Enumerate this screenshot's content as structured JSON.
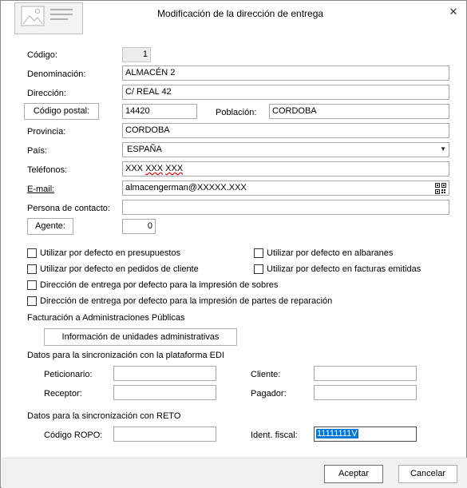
{
  "window": {
    "title": "Modificación de la dirección de entrega"
  },
  "fields": {
    "codigo": {
      "label": "Código:",
      "value": "1"
    },
    "denominacion": {
      "label": "Denominación:",
      "value": "ALMACÉN 2"
    },
    "direccion": {
      "label": "Dirección:",
      "value": "C/ REAL 42"
    },
    "codigo_postal": {
      "button": "Código postal:",
      "value": "14420"
    },
    "poblacion": {
      "label": "Población:",
      "value": "CORDOBA"
    },
    "provincia": {
      "label": "Provincia:",
      "value": "CORDOBA"
    },
    "pais": {
      "label": "País:",
      "value": "ESPAÑA"
    },
    "telefonos": {
      "label": "Teléfonos:",
      "value_a": "XXX",
      "value_b": "XXX",
      "value_c": "XXX"
    },
    "email": {
      "label": "E-mail:",
      "value": "almacengerman@XXXXX.XXX"
    },
    "persona_contacto": {
      "label": "Persona de contacto:",
      "value": ""
    },
    "agente": {
      "button": "Agente:",
      "value": "0"
    }
  },
  "checkboxes": [
    {
      "label": "Utilizar por defecto en presupuestos",
      "checked": false
    },
    {
      "label": "Utilizar por defecto en albaranes",
      "checked": false
    },
    {
      "label": "Utilizar por defecto en pedidos de cliente",
      "checked": false
    },
    {
      "label": "Utilizar por defecto en facturas emitidas",
      "checked": false
    },
    {
      "label": "Dirección de entrega por defecto para la impresión de sobres",
      "checked": false
    },
    {
      "label": "Dirección de entrega por defecto para la impresión de partes de reparación",
      "checked": false
    }
  ],
  "administraciones": {
    "heading": "Facturación a Administraciones Públicas",
    "button": "Información de unidades administrativas"
  },
  "edi": {
    "heading": "Datos para la sincronización con la plataforma EDI",
    "peticionario": "Peticionario:",
    "cliente": "Cliente:",
    "receptor": "Receptor:",
    "pagador": "Pagador:"
  },
  "reto": {
    "heading": "Datos para la sincronización con RETO",
    "codigo_ropo": "Código ROPO:",
    "ident_fiscal_label": "Ident. fiscal:",
    "ident_fiscal_value": "11111111V"
  },
  "footer": {
    "accept": "Aceptar",
    "cancel": "Cancelar"
  },
  "icons": {
    "logo": "address-card-icon",
    "close": "close-icon",
    "qr": "qr-code-icon",
    "dropdown": "chevron-down-icon"
  }
}
